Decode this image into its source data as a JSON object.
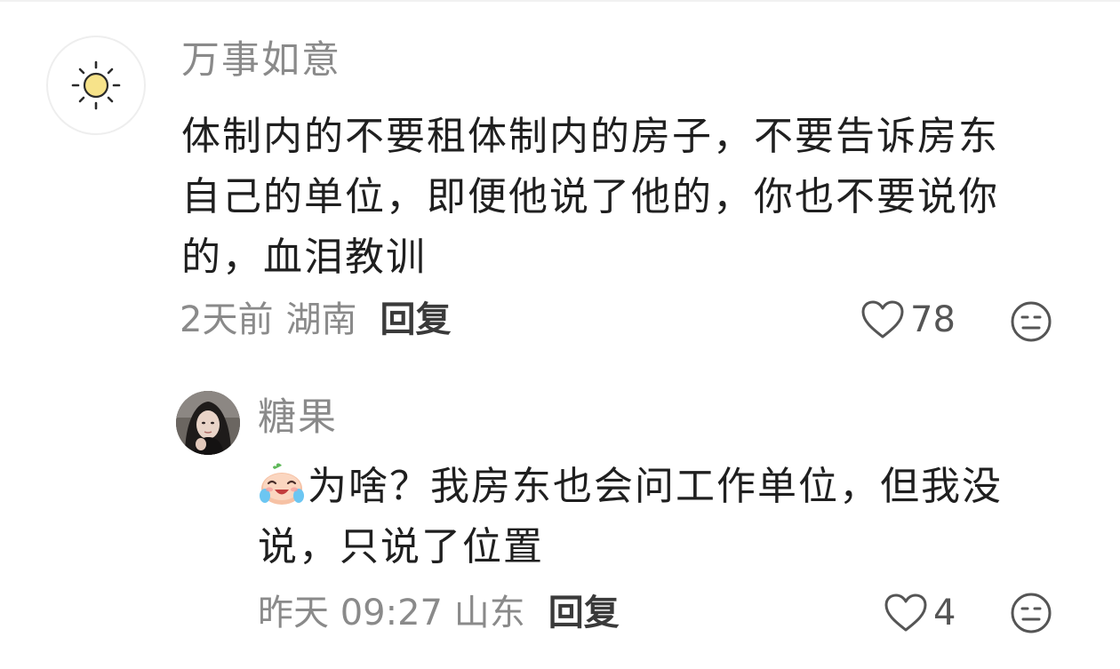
{
  "comment": {
    "username": "万事如意",
    "text_lines": [
      "体制内的不要租体制内的房子，不要告诉房东",
      "自己的单位，即便他说了他的，你也不要说你",
      "的，血泪教训"
    ],
    "time": "2天前",
    "location": "湖南",
    "reply_label": "回复",
    "like_count": "78",
    "avatar_icon": "sun-icon"
  },
  "reply": {
    "username": "糖果",
    "inline_emoji": "crying-laughing-emoji",
    "text_lines": [
      "为啥？我房东也会问工作单位，但我没",
      "说，只说了位置"
    ],
    "time": "昨天 09:27",
    "location": "山东",
    "reply_label": "回复",
    "like_count": "4"
  },
  "icons": {
    "like": "heart-outline-icon",
    "react": "neutral-face-icon"
  },
  "colors": {
    "text_primary": "#1f1f1f",
    "text_secondary": "#8a8a8a",
    "icon_gray": "#555555"
  }
}
